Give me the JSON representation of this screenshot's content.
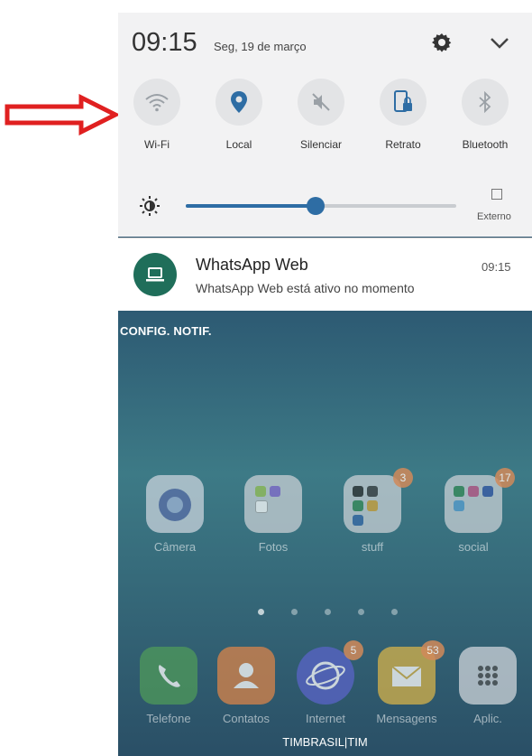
{
  "status": {
    "time": "09:15",
    "date": "Seg, 19 de março"
  },
  "quick_settings": [
    {
      "label": "Wi-Fi",
      "icon": "wifi-icon"
    },
    {
      "label": "Local",
      "icon": "location-pin-icon"
    },
    {
      "label": "Silenciar",
      "icon": "mute-icon"
    },
    {
      "label": "Retrato",
      "icon": "rotation-lock-icon"
    },
    {
      "label": "Bluetooth",
      "icon": "bluetooth-icon"
    }
  ],
  "brightness": {
    "level": 0.48,
    "external_label": "Externo"
  },
  "notification": {
    "title": "WhatsApp Web",
    "body": "WhatsApp Web está ativo no momento",
    "time": "09:15"
  },
  "config_label": "CONFIG. NOTIF.",
  "home_apps": [
    {
      "label": "Câmera",
      "badge": ""
    },
    {
      "label": "Fotos",
      "badge": ""
    },
    {
      "label": "stuff",
      "badge": "3"
    },
    {
      "label": "social",
      "badge": "17"
    }
  ],
  "dock_apps": [
    {
      "label": "Telefone",
      "badge": ""
    },
    {
      "label": "Contatos",
      "badge": ""
    },
    {
      "label": "Internet",
      "badge": "5"
    },
    {
      "label": "Mensagens",
      "badge": "53"
    },
    {
      "label": "Aplic.",
      "badge": ""
    }
  ],
  "carrier": "TIMBRASIL|TIM",
  "colors": {
    "accent": "#2e6da4",
    "whatsapp": "#1f6e5a",
    "arrow": "#e02020"
  }
}
